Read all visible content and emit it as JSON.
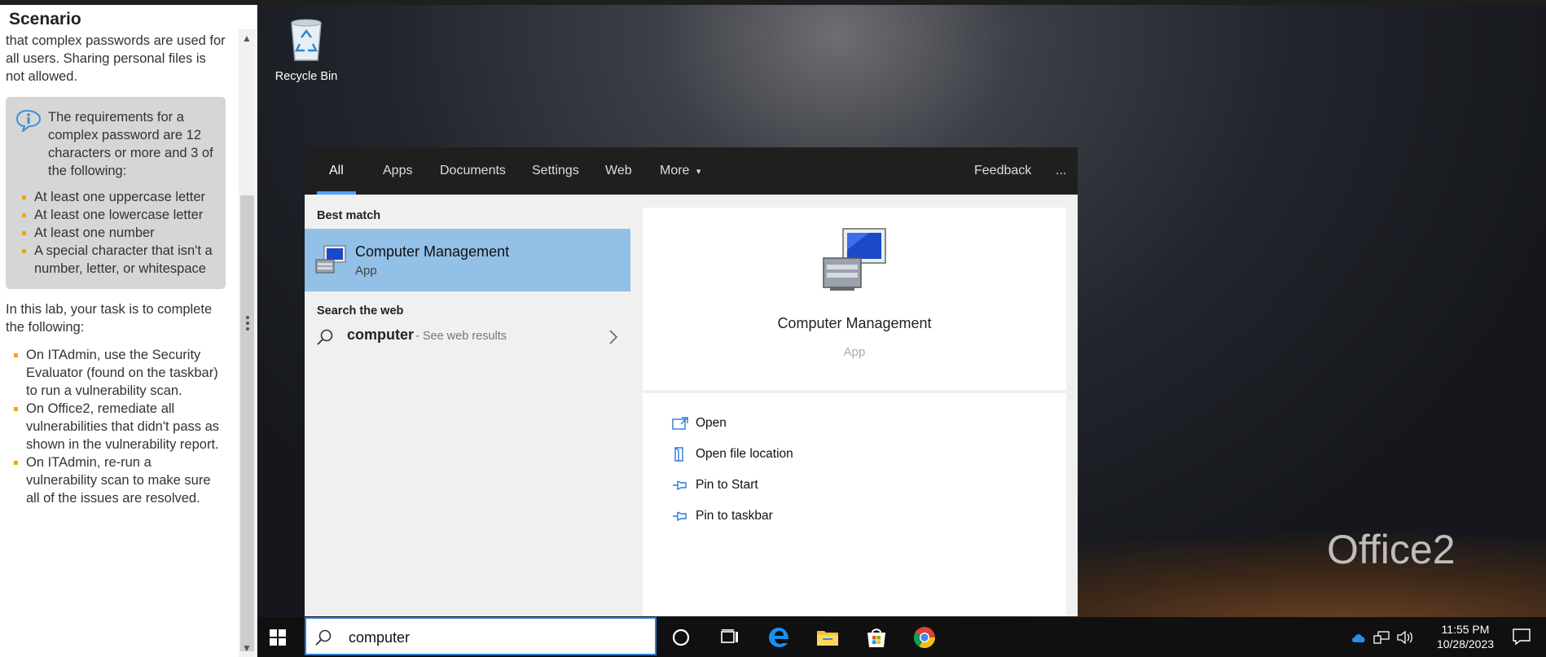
{
  "panel": {
    "title": "Scenario",
    "intro_tail": "that complex passwords are used for all users. Sharing personal files is not allowed.",
    "info_box": {
      "text": "The requirements for a complex password are 12 characters or more and 3 of the following:",
      "items": [
        "At least one uppercase letter",
        "At least one lowercase letter",
        "At least one number",
        "A special character that isn't a number, letter, or whitespace"
      ]
    },
    "task_intro": "In this lab, your task is to complete the following:",
    "tasks": [
      "On ITAdmin, use the Security Evaluator (found on the taskbar) to run a vulnerability scan.",
      "On Office2, remediate all vulnerabilities that didn't pass as shown in the vulnerability report.",
      "On ITAdmin, re-run a vulnerability scan to make sure all of the issues are resolved."
    ]
  },
  "desktop": {
    "recycle_bin_label": "Recycle Bin",
    "watermark": "Office2"
  },
  "search": {
    "tabs": [
      "All",
      "Apps",
      "Documents",
      "Settings",
      "Web",
      "More"
    ],
    "active_tab": "All",
    "more_arrow": "▾",
    "feedback": "Feedback",
    "ellipsis": "...",
    "best_match_heading": "Best match",
    "best_match": {
      "name": "Computer Management",
      "type": "App"
    },
    "web_heading": "Search the web",
    "web_query": "computer",
    "web_hint": "- See web results",
    "detail": {
      "name": "Computer Management",
      "type": "App"
    },
    "actions": [
      "Open",
      "Open file location",
      "Pin to Start",
      "Pin to taskbar"
    ]
  },
  "taskbar": {
    "search_value": "computer",
    "time": "11:55 PM",
    "date": "10/28/2023"
  }
}
